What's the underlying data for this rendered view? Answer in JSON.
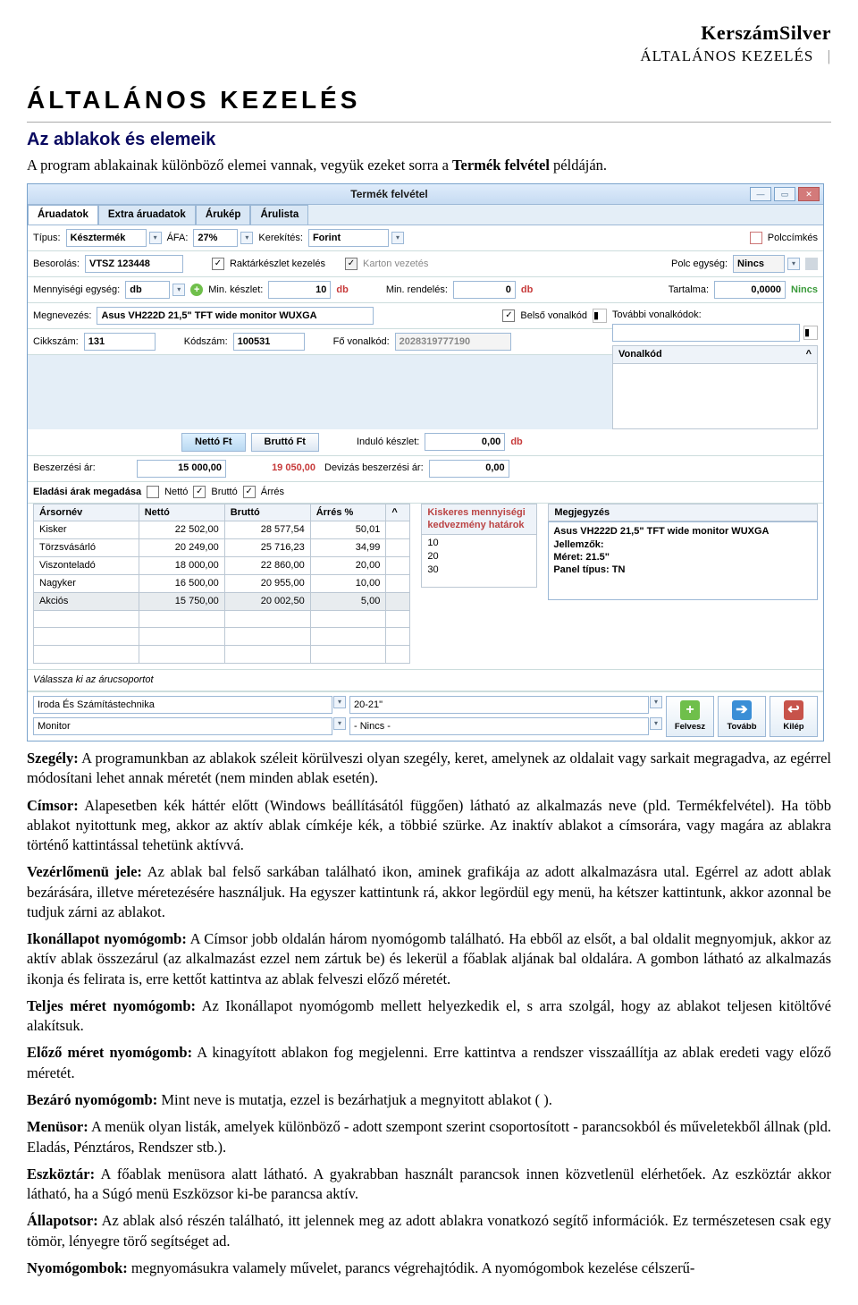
{
  "doc": {
    "brand": "KerszámSilver",
    "section": "ÁLTALÁNOS KEZELÉS",
    "barChar": "|",
    "h1": "ÁLTALÁNOS KEZELÉS",
    "h2": "Az ablakok és elemeik",
    "intro_a": "A program ablakainak különböző elemei vannak, vegyük ezeket sorra a ",
    "intro_b": "Termék felvétel",
    "intro_c": " példáján."
  },
  "win": {
    "title": "Termék felvétel",
    "tabs": [
      "Áruadatok",
      "Extra áruadatok",
      "Árukép",
      "Árulista"
    ],
    "row1": {
      "tipus_lbl": "Típus:",
      "tipus_val": "Késztermék",
      "afa_lbl": "ÁFA:",
      "afa_val": "27%",
      "kerek_lbl": "Kerekítés:",
      "kerek_val": "Forint",
      "polc_lbl": "Polccímkés"
    },
    "row2": {
      "besor_lbl": "Besorolás:",
      "besor_val": "VTSZ 123448",
      "rk_lbl": "Raktárkészlet kezelés",
      "kv_lbl": "Karton vezetés",
      "pe_lbl": "Polc egység:",
      "pe_val": "Nincs"
    },
    "row3": {
      "me_lbl": "Mennyiségi egység:",
      "me_val": "db",
      "mink_lbl": "Min. készlet:",
      "mink_val": "10",
      "mink_u": "db",
      "minr_lbl": "Min. rendelés:",
      "minr_val": "0",
      "minr_u": "db",
      "tart_lbl": "Tartalma:",
      "tart_val": "0,0000",
      "tart_u": "Nincs"
    },
    "row4": {
      "megnev_lbl": "Megnevezés:",
      "megnev_val": "Asus VH222D 21,5\" TFT wide monitor WUXGA",
      "bv_lbl": "Belső vonalkód",
      "tov_lbl": "További vonalkódok:"
    },
    "row5": {
      "cs_lbl": "Cikkszám:",
      "cs_val": "131",
      "ks_lbl": "Kódszám:",
      "ks_val": "100531",
      "fv_lbl": "Fő vonalkód:",
      "fv_val": "2028319777190"
    },
    "barcode_hdr_a": "Vonalkód",
    "barcode_hdr_b": "^",
    "row6": {
      "btn_netto": "Nettó Ft",
      "btn_brutto": "Bruttó Ft",
      "ik_lbl": "Induló készlet:",
      "ik_val": "0,00",
      "ik_u": "db"
    },
    "row7": {
      "besz_lbl": "Beszerzési ár:",
      "besz_val": "15 000,00",
      "besz_eur": "19 050,00",
      "dev_lbl": "Devizás beszerzési ár:",
      "dev_val": "0,00"
    },
    "row8": {
      "em_lbl": "Eladási árak megadása",
      "netto_lbl": "Nettó",
      "brutto_lbl": "Bruttó",
      "arres_lbl": "Árrés"
    },
    "price_hdr": [
      "Ársornév",
      "Nettó",
      "Bruttó",
      "Árrés %",
      "^"
    ],
    "price_rows": [
      [
        "Kisker",
        "22 502,00",
        "28 577,54",
        "50,01"
      ],
      [
        "Törzsvásárló",
        "20 249,00",
        "25 716,23",
        "34,99"
      ],
      [
        "Viszonteladó",
        "18 000,00",
        "22 860,00",
        "20,00"
      ],
      [
        "Nagyker",
        "16 500,00",
        "20 955,00",
        "10,00"
      ],
      [
        "Akciós",
        "15 750,00",
        "20 002,50",
        "5,00"
      ]
    ],
    "disc_hdr": "Kiskeres mennyiségi kedvezmény határok",
    "disc_vals": [
      "10",
      "20",
      "30"
    ],
    "memo_lbl": "Megjegyzés",
    "memo_lines": [
      "Asus VH222D 21,5\" TFT wide monitor WUXGA",
      "Jellemzők:",
      "Méret: 21.5\"",
      "Panel típus: TN"
    ],
    "grp_lbl": "Válassza ki az árucsoportot",
    "sel1": "Iroda És Számítástechnika",
    "sel2": "Monitor",
    "sel3": "20-21\"",
    "sel4": "- Nincs -",
    "btn_add": "Felvesz",
    "btn_next": "Tovább",
    "btn_exit": "Kilép"
  },
  "body": {
    "p1a": "Szegély:",
    "p1b": " A programunkban az ablakok széleit körülveszi olyan szegély, keret, amelynek az oldalait vagy sarkait megragadva, az egérrel módosítani lehet annak méretét (nem minden ablak esetén).",
    "p2a": "Címsor:",
    "p2b": " Alapesetben kék háttér előtt (Windows beállításától függően) látható az alkalmazás neve (pld. Termékfelvétel). Ha több ablakot nyitottunk meg, akkor az aktív ablak címkéje kék, a többié szürke. Az inaktív ablakot a címsorára, vagy magára az ablakra történő kattintással tehetünk aktívvá.",
    "p3a": "Vezérlőmenü jele:",
    "p3b": " Az ablak bal felső sarkában található ikon, aminek grafikája az adott alkalmazásra utal. Egérrel az adott ablak bezárására, illetve méretezésére használjuk. Ha egyszer kattintunk rá, akkor legördül egy menü, ha kétszer kattintunk, akkor azonnal be tudjuk zárni az ablakot.",
    "p4a": "Ikonállapot nyomógomb:",
    "p4b": " A Címsor jobb oldalán három nyomógomb található. Ha ebből az elsőt, a bal oldalit megnyomjuk, akkor az aktív ablak összezárul (az alkalmazást ezzel nem zártuk be) és lekerül a főablak aljának bal oldalára. A gombon látható az alkalmazás ikonja és felirata is, erre kettőt kattintva az ablak felveszi előző méretét.",
    "p5a": "Teljes méret nyomógomb:",
    "p5b": " Az Ikonállapot nyomógomb mellett helyezkedik el, s arra szolgál, hogy az ablakot teljesen kitöltővé alakítsuk.",
    "p6a": "Előző méret nyomógomb:",
    "p6b": " A kinagyított ablakon fog megjelenni. Erre kattintva a rendszer visszaállítja az ablak eredeti vagy előző méretét.",
    "p7a": "Bezáró nyomógomb:",
    "p7b": " Mint neve is mutatja, ezzel is bezárhatjuk a megnyitott ablakot ( ).",
    "p8a": "Menüsor:",
    "p8b": " A menük olyan listák, amelyek különböző - adott szempont szerint csoportosított - parancsokból és műveletekből állnak (pld. Eladás, Pénztáros, Rendszer stb.).",
    "p9a": "Eszköztár:",
    "p9b": " A főablak menüsora alatt látható. A gyakrabban használt parancsok innen közvetlenül elérhetőek. Az eszköztár akkor látható, ha a Súgó menü Eszközsor ki-be parancsa aktív.",
    "p10a": "Állapotsor:",
    "p10b": " Az ablak alsó részén található, itt jelennek meg az adott ablakra vonatkozó segítő információk. Ez természetesen csak egy tömör, lényegre törő segítséget ad.",
    "p11a": "Nyomógombok:",
    "p11b": " megnyomásukra valamely művelet, parancs végrehajtódik. A nyomógombok kezelése célszerű-"
  }
}
